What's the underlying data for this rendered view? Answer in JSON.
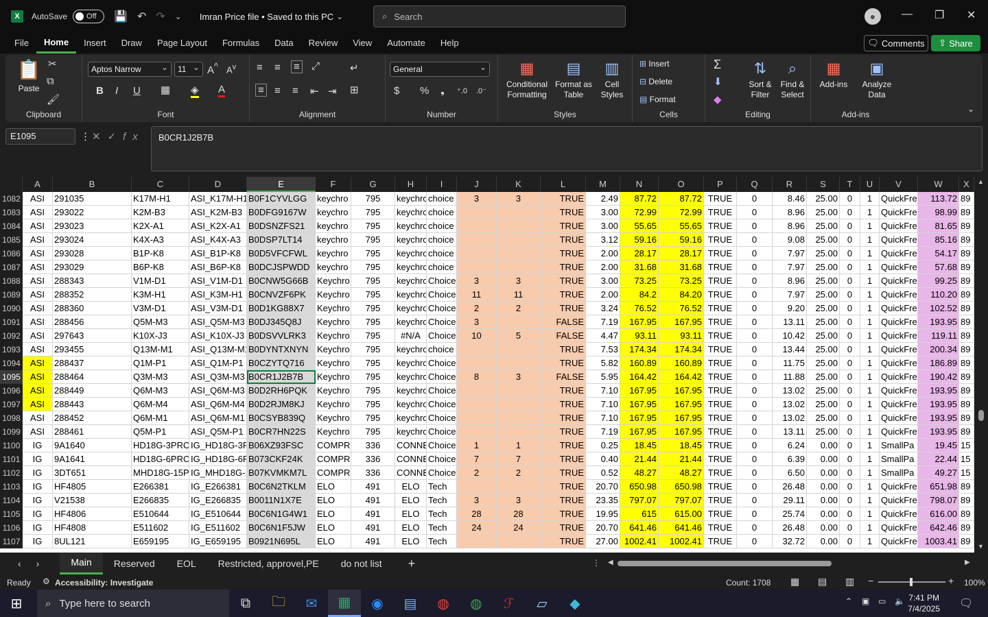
{
  "titlebar": {
    "app_letter": "X",
    "autosave_label": "AutoSave",
    "autosave_state": "Off",
    "doc_title": "Imran Price file • Saved to this PC",
    "search_placeholder": "Search"
  },
  "menu": {
    "items": [
      "File",
      "Home",
      "Insert",
      "Draw",
      "Page Layout",
      "Formulas",
      "Data",
      "Review",
      "View",
      "Automate",
      "Help"
    ],
    "active": "Home",
    "comments": "Comments",
    "share": "Share"
  },
  "ribbon": {
    "clipboard": {
      "label": "Clipboard",
      "paste": "Paste"
    },
    "font": {
      "label": "Font",
      "name": "Aptos Narrow",
      "size": "11",
      "bold": "B",
      "italic": "I",
      "underline": "U"
    },
    "alignment": {
      "label": "Alignment"
    },
    "number": {
      "label": "Number",
      "format": "General"
    },
    "styles": {
      "label": "Styles",
      "conditional": "Conditional Formatting",
      "format_table": "Format as Table",
      "cell_styles": "Cell Styles"
    },
    "cells": {
      "label": "Cells",
      "insert": "Insert",
      "delete": "Delete",
      "format": "Format"
    },
    "editing": {
      "label": "Editing",
      "sort": "Sort & Filter",
      "find": "Find & Select"
    },
    "addins": {
      "label": "Add-ins",
      "addins": "Add-ins",
      "analyze": "Analyze Data"
    }
  },
  "formula_bar": {
    "name_box": "E1095",
    "fx": "fx",
    "value": "B0CR1J2B7B"
  },
  "columns": [
    "A",
    "B",
    "C",
    "D",
    "E",
    "F",
    "G",
    "H",
    "I",
    "J",
    "K",
    "L",
    "M",
    "N",
    "O",
    "P",
    "Q",
    "R",
    "S",
    "T",
    "U",
    "V",
    "W",
    "X"
  ],
  "rows": [
    {
      "n": "1082",
      "a": "ASI",
      "b": "291035",
      "c": "K17M-H1",
      "d": "ASI_K17M-H1",
      "e": "B0F1CYVLGG",
      "f": "keychro",
      "g": "795",
      "h": "keychro",
      "i": "choice",
      "j": "3",
      "k": "3",
      "l": "TRUE",
      "m": "2.49",
      "nn": "87.72",
      "o": "87.72",
      "p": "TRUE",
      "q": "0",
      "r": "8.46",
      "s": "25.00",
      "t": "0",
      "u": "1",
      "v": "QuickFre",
      "w": "113.72",
      "x": "89"
    },
    {
      "n": "1083",
      "a": "ASI",
      "b": "293022",
      "c": "K2M-B3",
      "d": "ASI_K2M-B3",
      "e": "B0DFG9167W",
      "f": "keychro",
      "g": "795",
      "h": "keychro",
      "i": "choice",
      "j": "",
      "k": "",
      "l": "TRUE",
      "m": "3.00",
      "nn": "72.99",
      "o": "72.99",
      "p": "TRUE",
      "q": "0",
      "r": "8.96",
      "s": "25.00",
      "t": "0",
      "u": "1",
      "v": "QuickFre",
      "w": "98.99",
      "x": "89"
    },
    {
      "n": "1084",
      "a": "ASI",
      "b": "293023",
      "c": "K2X-A1",
      "d": "ASI_K2X-A1",
      "e": "B0DSNZFS21",
      "f": "keychro",
      "g": "795",
      "h": "keychro",
      "i": "choice",
      "j": "",
      "k": "",
      "l": "TRUE",
      "m": "3.00",
      "nn": "55.65",
      "o": "55.65",
      "p": "TRUE",
      "q": "0",
      "r": "8.96",
      "s": "25.00",
      "t": "0",
      "u": "1",
      "v": "QuickFre",
      "w": "81.65",
      "x": "89"
    },
    {
      "n": "1085",
      "a": "ASI",
      "b": "293024",
      "c": "K4X-A3",
      "d": "ASI_K4X-A3",
      "e": "B0DSP7LT14",
      "f": "keychro",
      "g": "795",
      "h": "keychro",
      "i": "choice",
      "j": "",
      "k": "",
      "l": "TRUE",
      "m": "3.12",
      "nn": "59.16",
      "o": "59.16",
      "p": "TRUE",
      "q": "0",
      "r": "9.08",
      "s": "25.00",
      "t": "0",
      "u": "1",
      "v": "QuickFre",
      "w": "85.16",
      "x": "89"
    },
    {
      "n": "1086",
      "a": "ASI",
      "b": "293028",
      "c": "B1P-K8",
      "d": "ASI_B1P-K8",
      "e": "B0D5VFCFWL",
      "f": "keychro",
      "g": "795",
      "h": "keychro",
      "i": "choice",
      "j": "",
      "k": "",
      "l": "TRUE",
      "m": "2.00",
      "nn": "28.17",
      "o": "28.17",
      "p": "TRUE",
      "q": "0",
      "r": "7.97",
      "s": "25.00",
      "t": "0",
      "u": "1",
      "v": "QuickFre",
      "w": "54.17",
      "x": "89"
    },
    {
      "n": "1087",
      "a": "ASI",
      "b": "293029",
      "c": "B6P-K8",
      "d": "ASI_B6P-K8",
      "e": "B0DCJSPWDD",
      "f": "keychro",
      "g": "795",
      "h": "keychro",
      "i": "choice",
      "j": "",
      "k": "",
      "l": "TRUE",
      "m": "2.00",
      "nn": "31.68",
      "o": "31.68",
      "p": "TRUE",
      "q": "0",
      "r": "7.97",
      "s": "25.00",
      "t": "0",
      "u": "1",
      "v": "QuickFre",
      "w": "57.68",
      "x": "89"
    },
    {
      "n": "1088",
      "a": "ASI",
      "b": "288343",
      "c": "V1M-D1",
      "d": "ASI_V1M-D1",
      "e": "B0CNW5G66B",
      "f": "Keychro",
      "g": "795",
      "h": "keychro",
      "i": "Choice",
      "j": "3",
      "k": "3",
      "l": "TRUE",
      "m": "3.00",
      "nn": "73.25",
      "o": "73.25",
      "p": "TRUE",
      "q": "0",
      "r": "8.96",
      "s": "25.00",
      "t": "0",
      "u": "1",
      "v": "QuickFre",
      "w": "99.25",
      "x": "89"
    },
    {
      "n": "1089",
      "a": "ASI",
      "b": "288352",
      "c": "K3M-H1",
      "d": "ASI_K3M-H1",
      "e": "B0CNVZF6PK",
      "f": "Keychro",
      "g": "795",
      "h": "keychro",
      "i": "Choice",
      "j": "11",
      "k": "11",
      "l": "TRUE",
      "m": "2.00",
      "nn": "84.2",
      "o": "84.20",
      "p": "TRUE",
      "q": "0",
      "r": "7.97",
      "s": "25.00",
      "t": "0",
      "u": "1",
      "v": "QuickFre",
      "w": "110.20",
      "x": "89"
    },
    {
      "n": "1090",
      "a": "ASI",
      "b": "288360",
      "c": "V3M-D1",
      "d": "ASI_V3M-D1",
      "e": "B0D1KG88X7",
      "f": "Keychro",
      "g": "795",
      "h": "keychro",
      "i": "Choice",
      "j": "2",
      "k": "2",
      "l": "TRUE",
      "m": "3.24",
      "nn": "76.52",
      "o": "76.52",
      "p": "TRUE",
      "q": "0",
      "r": "9.20",
      "s": "25.00",
      "t": "0",
      "u": "1",
      "v": "QuickFre",
      "w": "102.52",
      "x": "89"
    },
    {
      "n": "1091",
      "a": "ASI",
      "b": "288456",
      "c": "Q5M-M3",
      "d": "ASI_Q5M-M3",
      "e": "B0DJ345Q8J",
      "f": "Keychro",
      "g": "795",
      "h": "keychro",
      "i": "Choice",
      "j": "3",
      "k": "",
      "l": "FALSE",
      "m": "7.19",
      "nn": "167.95",
      "o": "167.95",
      "p": "TRUE",
      "q": "0",
      "r": "13.11",
      "s": "25.00",
      "t": "0",
      "u": "1",
      "v": "QuickFre",
      "w": "193.95",
      "x": "89"
    },
    {
      "n": "1092",
      "a": "ASI",
      "b": "297643",
      "c": "K10X-J3",
      "d": "ASI_K10X-J3",
      "e": "B0DSVVLRK3",
      "f": "Keychro",
      "g": "795",
      "h": "#N/A",
      "i": "Choice",
      "j": "10",
      "k": "5",
      "l": "FALSE",
      "m": "4.47",
      "nn": "93.11",
      "o": "93.11",
      "p": "TRUE",
      "q": "0",
      "r": "10.42",
      "s": "25.00",
      "t": "0",
      "u": "1",
      "v": "QuickFre",
      "w": "119.11",
      "x": "89"
    },
    {
      "n": "1093",
      "a": "ASI",
      "b": "293455",
      "c": "Q13M-M1",
      "d": "ASI_Q13M-M1",
      "e": "B0DYNTXNYN",
      "f": "Keychro",
      "g": "795",
      "h": "keychro",
      "i": "choice",
      "j": "",
      "k": "",
      "l": "TRUE",
      "m": "7.53",
      "nn": "174.34",
      "o": "174.34",
      "p": "TRUE",
      "q": "0",
      "r": "13.44",
      "s": "25.00",
      "t": "0",
      "u": "1",
      "v": "QuickFre",
      "w": "200.34",
      "x": "89"
    },
    {
      "n": "1094",
      "a": "ASI",
      "b": "288437",
      "c": "Q1M-P1",
      "d": "ASI_Q1M-P1",
      "e": "B0CZYTQ716",
      "f": "Keychro",
      "g": "795",
      "h": "keychro",
      "i": "Choice",
      "j": "",
      "k": "",
      "l": "TRUE",
      "m": "5.82",
      "nn": "160.89",
      "o": "160.89",
      "p": "TRUE",
      "q": "0",
      "r": "11.75",
      "s": "25.00",
      "t": "0",
      "u": "1",
      "v": "QuickFre",
      "w": "186.89",
      "x": "89",
      "hl": true
    },
    {
      "n": "1095",
      "a": "ASI",
      "b": "288464",
      "c": "Q3M-M3",
      "d": "ASI_Q3M-M3",
      "e": "B0CR1J2B7B",
      "f": "Keychro",
      "g": "795",
      "h": "keychro",
      "i": "Choice",
      "j": "8",
      "k": "3",
      "l": "FALSE",
      "m": "5.95",
      "nn": "164.42",
      "o": "164.42",
      "p": "TRUE",
      "q": "0",
      "r": "11.88",
      "s": "25.00",
      "t": "0",
      "u": "1",
      "v": "QuickFre",
      "w": "190.42",
      "x": "89",
      "hl": true,
      "active": true
    },
    {
      "n": "1096",
      "a": "ASI",
      "b": "288449",
      "c": "Q6M-M3",
      "d": "ASI_Q6M-M3",
      "e": "B0D2RH6PQK",
      "f": "Keychro",
      "g": "795",
      "h": "keychro",
      "i": "Choice",
      "j": "",
      "k": "",
      "l": "TRUE",
      "m": "7.10",
      "nn": "167.95",
      "o": "167.95",
      "p": "TRUE",
      "q": "0",
      "r": "13.02",
      "s": "25.00",
      "t": "0",
      "u": "1",
      "v": "QuickFre",
      "w": "193.95",
      "x": "89",
      "hl": true
    },
    {
      "n": "1097",
      "a": "ASI",
      "b": "288443",
      "c": "Q6M-M4",
      "d": "ASI_Q6M-M4",
      "e": "B0D2RJM8KJ",
      "f": "Keychro",
      "g": "795",
      "h": "keychro",
      "i": "Choice",
      "j": "",
      "k": "",
      "l": "TRUE",
      "m": "7.10",
      "nn": "167.95",
      "o": "167.95",
      "p": "TRUE",
      "q": "0",
      "r": "13.02",
      "s": "25.00",
      "t": "0",
      "u": "1",
      "v": "QuickFre",
      "w": "193.95",
      "x": "89",
      "hl": true
    },
    {
      "n": "1098",
      "a": "ASI",
      "b": "288452",
      "c": "Q6M-M1",
      "d": "ASI_Q6M-M1",
      "e": "B0CSYB839Q",
      "f": "Keychro",
      "g": "795",
      "h": "keychro",
      "i": "Choice",
      "j": "",
      "k": "",
      "l": "TRUE",
      "m": "7.10",
      "nn": "167.95",
      "o": "167.95",
      "p": "TRUE",
      "q": "0",
      "r": "13.02",
      "s": "25.00",
      "t": "0",
      "u": "1",
      "v": "QuickFre",
      "w": "193.95",
      "x": "89"
    },
    {
      "n": "1099",
      "a": "ASI",
      "b": "288461",
      "c": "Q5M-P1",
      "d": "ASI_Q5M-P1",
      "e": "B0CR7HN22S",
      "f": "Keychro",
      "g": "795",
      "h": "keychro",
      "i": "Choice",
      "j": "",
      "k": "",
      "l": "TRUE",
      "m": "7.19",
      "nn": "167.95",
      "o": "167.95",
      "p": "TRUE",
      "q": "0",
      "r": "13.11",
      "s": "25.00",
      "t": "0",
      "u": "1",
      "v": "QuickFre",
      "w": "193.95",
      "x": "89"
    },
    {
      "n": "1100",
      "a": "IG",
      "b": "9A1640",
      "c": "HD18G-3PRO",
      "d": "IG_HD18G-3P",
      "e": "B06XZ93FSC",
      "f": "COMPRE",
      "g": "336",
      "h": "CONNE",
      "i": "Choice",
      "j": "1",
      "k": "1",
      "l": "TRUE",
      "m": "0.25",
      "nn": "18.45",
      "o": "18.45",
      "p": "TRUE",
      "q": "0",
      "r": "6.24",
      "s": "0.00",
      "t": "0",
      "u": "1",
      "v": "SmallPa",
      "w": "19.45",
      "x": "15"
    },
    {
      "n": "1101",
      "a": "IG",
      "b": "9A1641",
      "c": "HD18G-6PRO",
      "d": "IG_HD18G-6P",
      "e": "B073CKF24K",
      "f": "COMPRE",
      "g": "336",
      "h": "CONNE",
      "i": "Choice",
      "j": "7",
      "k": "7",
      "l": "TRUE",
      "m": "0.40",
      "nn": "21.44",
      "o": "21.44",
      "p": "TRUE",
      "q": "0",
      "r": "6.39",
      "s": "0.00",
      "t": "0",
      "u": "1",
      "v": "SmallPa",
      "w": "22.44",
      "x": "15"
    },
    {
      "n": "1102",
      "a": "IG",
      "b": "3DT651",
      "c": "MHD18G-15P",
      "d": "IG_MHD18G-1",
      "e": "B07KVMKM7L",
      "f": "COMPRE",
      "g": "336",
      "h": "CONNE",
      "i": "Choice",
      "j": "2",
      "k": "2",
      "l": "TRUE",
      "m": "0.52",
      "nn": "48.27",
      "o": "48.27",
      "p": "TRUE",
      "q": "0",
      "r": "6.50",
      "s": "0.00",
      "t": "0",
      "u": "1",
      "v": "SmallPa",
      "w": "49.27",
      "x": "15"
    },
    {
      "n": "1103",
      "a": "IG",
      "b": "HF4805",
      "c": "E266381",
      "d": "IG_E266381",
      "e": "B0C6N2TKLM",
      "f": "ELO",
      "g": "491",
      "h": "ELO",
      "i": "Tech",
      "j": "",
      "k": "",
      "l": "TRUE",
      "m": "20.70",
      "nn": "650.98",
      "o": "650.98",
      "p": "TRUE",
      "q": "0",
      "r": "26.48",
      "s": "0.00",
      "t": "0",
      "u": "1",
      "v": "QuickFre",
      "w": "651.98",
      "x": "89"
    },
    {
      "n": "1104",
      "a": "IG",
      "b": "V21538",
      "c": "E266835",
      "d": "IG_E266835",
      "e": "B0011N1X7E",
      "f": "ELO",
      "g": "491",
      "h": "ELO",
      "i": "Tech",
      "j": "3",
      "k": "3",
      "l": "TRUE",
      "m": "23.35",
      "nn": "797.07",
      "o": "797.07",
      "p": "TRUE",
      "q": "0",
      "r": "29.11",
      "s": "0.00",
      "t": "0",
      "u": "1",
      "v": "QuickFre",
      "w": "798.07",
      "x": "89"
    },
    {
      "n": "1105",
      "a": "IG",
      "b": "HF4806",
      "c": "E510644",
      "d": "IG_E510644",
      "e": "B0C6N1G4W1",
      "f": "ELO",
      "g": "491",
      "h": "ELO",
      "i": "Tech",
      "j": "28",
      "k": "28",
      "l": "TRUE",
      "m": "19.95",
      "nn": "615",
      "o": "615.00",
      "p": "TRUE",
      "q": "0",
      "r": "25.74",
      "s": "0.00",
      "t": "0",
      "u": "1",
      "v": "QuickFre",
      "w": "616.00",
      "x": "89"
    },
    {
      "n": "1106",
      "a": "IG",
      "b": "HF4808",
      "c": "E511602",
      "d": "IG_E511602",
      "e": "B0C6N1F5JW",
      "f": "ELO",
      "g": "491",
      "h": "ELO",
      "i": "Tech",
      "j": "24",
      "k": "24",
      "l": "TRUE",
      "m": "20.70",
      "nn": "641.46",
      "o": "641.46",
      "p": "TRUE",
      "q": "0",
      "r": "26.48",
      "s": "0.00",
      "t": "0",
      "u": "1",
      "v": "QuickFre",
      "w": "642.46",
      "x": "89"
    },
    {
      "n": "1107",
      "a": "IG",
      "b": "8UL121",
      "c": "E659195",
      "d": "IG_E659195",
      "e": "B0921N695L",
      "f": "ELO",
      "g": "491",
      "h": "ELO",
      "i": "Tech",
      "j": "",
      "k": "",
      "l": "TRUE",
      "m": "27.00",
      "nn": "1002.41",
      "o": "1002.41",
      "p": "TRUE",
      "q": "0",
      "r": "32.72",
      "s": "0.00",
      "t": "0",
      "u": "1",
      "v": "QuickFre",
      "w": "1003.41",
      "x": "89"
    }
  ],
  "sheets": [
    "Main",
    "Reserved",
    "EOL",
    "Restricted, approvel,PE",
    "do not list"
  ],
  "active_sheet": "Main",
  "status": {
    "ready": "Ready",
    "accessibility": "Accessibility: Investigate",
    "count": "Count: 1708",
    "zoom": "100%"
  },
  "taskbar": {
    "search_placeholder": "Type here to search",
    "time": "7:41 PM",
    "date": "7/4/2025"
  }
}
